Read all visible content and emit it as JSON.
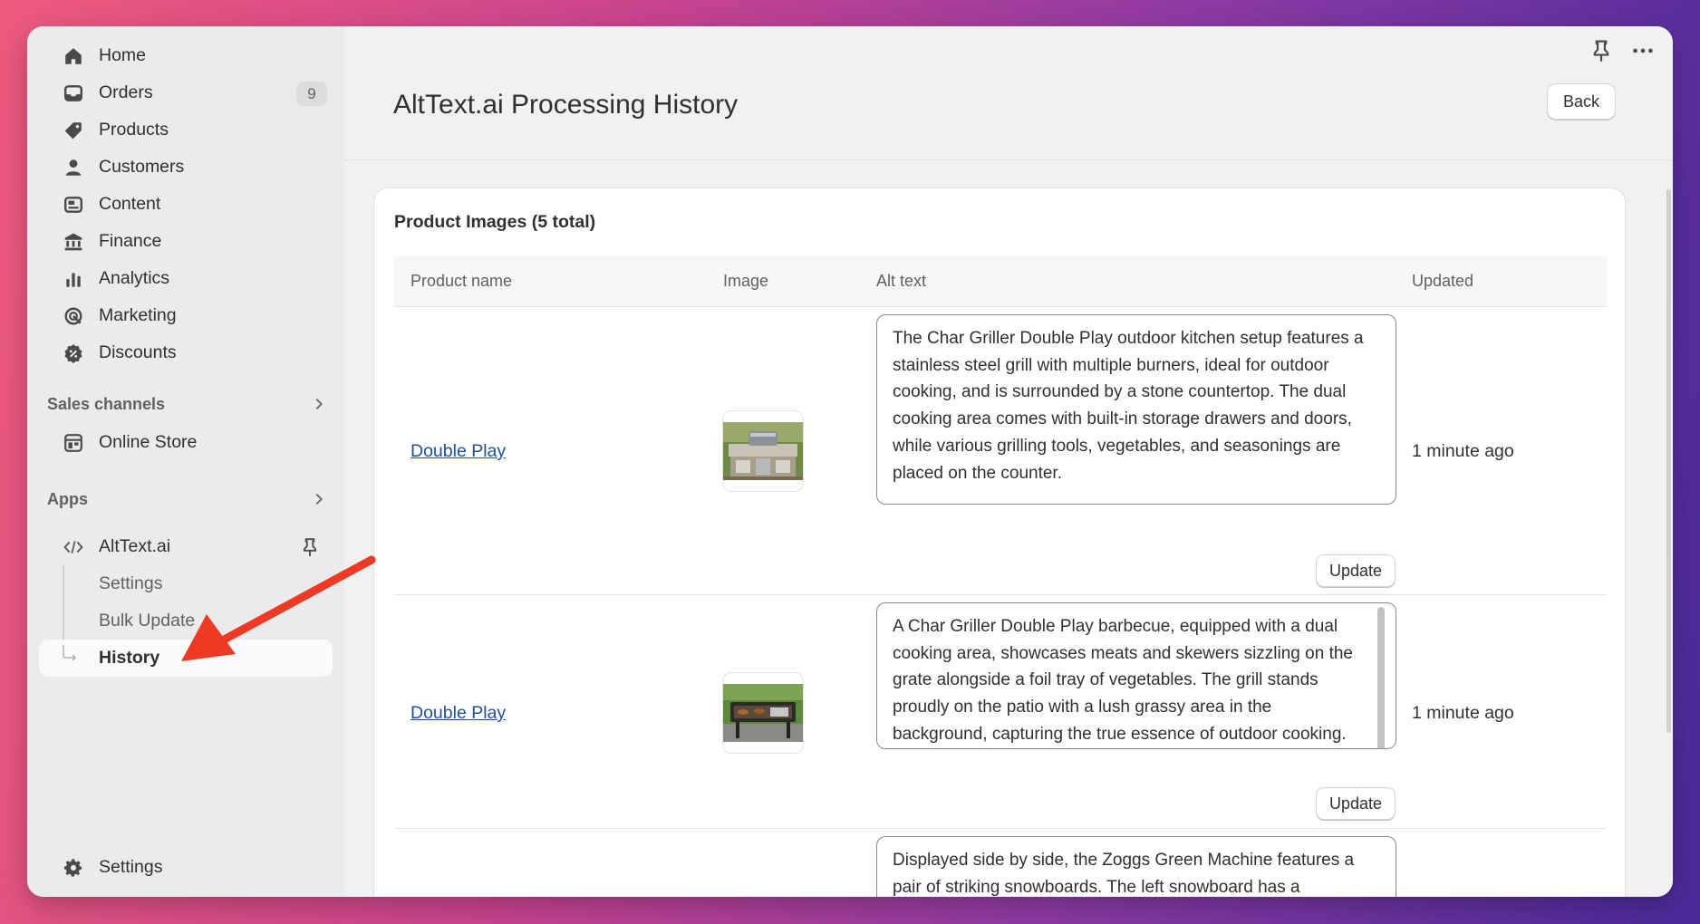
{
  "sidebar": {
    "items": [
      {
        "label": "Home",
        "icon": "home-icon"
      },
      {
        "label": "Orders",
        "icon": "inbox-icon",
        "badge": "9"
      },
      {
        "label": "Products",
        "icon": "tag-icon"
      },
      {
        "label": "Customers",
        "icon": "person-icon"
      },
      {
        "label": "Content",
        "icon": "content-icon"
      },
      {
        "label": "Finance",
        "icon": "bank-icon"
      },
      {
        "label": "Analytics",
        "icon": "bar-chart-icon"
      },
      {
        "label": "Marketing",
        "icon": "target-icon"
      },
      {
        "label": "Discounts",
        "icon": "discount-icon"
      }
    ],
    "sales_channels_label": "Sales channels",
    "online_store_label": "Online Store",
    "apps_label": "Apps",
    "app_name": "AltText.ai",
    "app_sub_items": [
      "Settings",
      "Bulk Update",
      "History"
    ],
    "settings_label": "Settings"
  },
  "header": {
    "title": "AltText.ai Processing History",
    "back_label": "Back"
  },
  "card": {
    "title": "Product Images (5 total)",
    "columns": [
      "Product name",
      "Image",
      "Alt text",
      "Updated"
    ],
    "rows": [
      {
        "product": "Double Play",
        "alt_text": "The Char Griller Double Play outdoor kitchen setup features a stainless steel grill with multiple burners, ideal for outdoor cooking, and is surrounded by a stone countertop. The dual cooking area comes with built-in storage drawers and doors, while various grilling tools, vegetables, and seasonings are placed on the counter.",
        "updated": "1 minute ago",
        "button": "Update"
      },
      {
        "product": "Double Play",
        "alt_text": "A Char Griller Double Play barbecue, equipped with a dual cooking area, showcases meats and skewers sizzling on the grate alongside a foil tray of vegetables. The grill stands proudly on the patio with a lush grassy area in the background, capturing the true essence of outdoor cooking.",
        "updated": "1 minute ago",
        "button": "Update"
      },
      {
        "alt_text": "Displayed side by side, the Zoggs Green Machine features a pair of striking snowboards. The left snowboard has a"
      }
    ]
  },
  "colors": {
    "accent_link": "#1f5199",
    "annotation_arrow": "#ee3a24"
  }
}
